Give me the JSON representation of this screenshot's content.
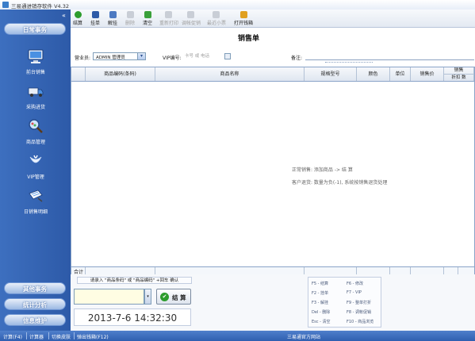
{
  "window": {
    "title": "三易通进销存软件 V4.32"
  },
  "sidebar": {
    "collapse_glyph": "«",
    "top_section": "日常事务",
    "items": [
      {
        "label": "前台销售",
        "icon": "monitor-icon"
      },
      {
        "label": "采购进货",
        "icon": "truck-icon"
      },
      {
        "label": "商品管理",
        "icon": "magnifier-icon"
      },
      {
        "label": "VIP管理",
        "icon": "vip-icon"
      },
      {
        "label": "日销售明细",
        "icon": "notebook-icon"
      }
    ],
    "bottom_sections": [
      "其他事务",
      "统计分析",
      "信息维护"
    ]
  },
  "toolbar": {
    "buttons": [
      {
        "label": "结算",
        "enabled": true,
        "color": "#2d9c2d"
      },
      {
        "label": "挂单",
        "enabled": true,
        "color": "#2d5aa8"
      },
      {
        "label": "解挂",
        "enabled": true,
        "color": "#4d7ac2"
      },
      {
        "label": "删除",
        "enabled": false,
        "color": "#c9ced6"
      },
      {
        "label": "清空",
        "enabled": true,
        "color": "#3aa03a"
      },
      {
        "label": "重新打印",
        "enabled": false,
        "color": "#c9ced6"
      },
      {
        "label": "调帐促销",
        "enabled": false,
        "color": "#c9ced6"
      },
      {
        "label": "最近小票",
        "enabled": false,
        "color": "#c9ced6"
      },
      {
        "label": "打开钱箱",
        "enabled": true,
        "color": "#e0a020"
      }
    ]
  },
  "form": {
    "doc_title": "销售单",
    "salesperson_label": "营业员:",
    "salesperson_value": "ADMIN 管理员",
    "vip_label": "VIP编号:",
    "vip_placeholder": "卡号 或 电话",
    "memo_label": "备注:"
  },
  "grid": {
    "columns": [
      "商品编码(条码)",
      "商品名称",
      "规格型号",
      "颜色",
      "单位",
      "销售价",
      "销售"
    ],
    "sub_columns": [
      "折扣",
      "数"
    ],
    "hints": [
      "正常销售: 添加商品 -> 结 算",
      "客户退货: 数量为负(-1), 系统按销售退货处理"
    ],
    "footer_label": "合计"
  },
  "entry": {
    "scan_hint": "请录入 \"商品条码\" 或 \"商品编码\"  +回车 确认",
    "checkout_label": "结 算",
    "clock": "2013-7-6 14:32:30"
  },
  "shortcuts": [
    "F5 - 结算",
    "F6 - 修改",
    "F2 - 挂单",
    "F7 - VIP",
    "F3 - 解挂",
    "F9 - 整单打折",
    "Del - 删除",
    "F8 - 调帐促销",
    "Esc - 清空",
    "F10 - 商品浏览"
  ],
  "statusbar": {
    "items": [
      "计算(F4)",
      "计算器",
      "切换皮肤",
      "弹出钱箱(F12)"
    ],
    "website": "三易通官方网站"
  }
}
